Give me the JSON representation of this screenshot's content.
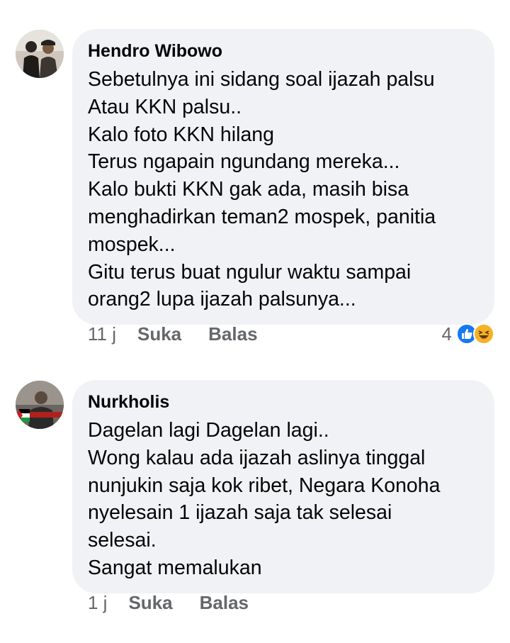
{
  "comments": [
    {
      "author": "Hendro Wibowo",
      "lines": [
        "Sebetulnya ini sidang soal ijazah palsu",
        "Atau KKN palsu..",
        "Kalo foto KKN hilang",
        "Terus ngapain ngundang mereka...",
        "Kalo bukti KKN gak ada, masih bisa",
        "menghadirkan teman2 mospek, panitia",
        "mospek...",
        "Gitu terus buat ngulur waktu sampai",
        "orang2 lupa ijazah palsunya..."
      ],
      "time": "11 j",
      "like_label": "Suka",
      "reply_label": "Balas",
      "reaction_count": "4",
      "reactions": [
        "like-icon",
        "haha-icon"
      ]
    },
    {
      "author": "Nurkholis",
      "lines": [
        "Dagelan lagi Dagelan lagi..",
        "Wong kalau ada ijazah aslinya tinggal",
        "nunjukin saja kok ribet, Negara Konoha",
        "nyelesain 1 ijazah saja tak selesai",
        "selesai.",
        "Sangat memalukan"
      ],
      "time": "1 j",
      "like_label": "Suka",
      "reply_label": "Balas"
    }
  ],
  "colors": {
    "bubble": "#f0f2f5",
    "meta_text": "#65676b",
    "like_blue": "#1877f2",
    "haha_yellow": "#f7b125"
  }
}
